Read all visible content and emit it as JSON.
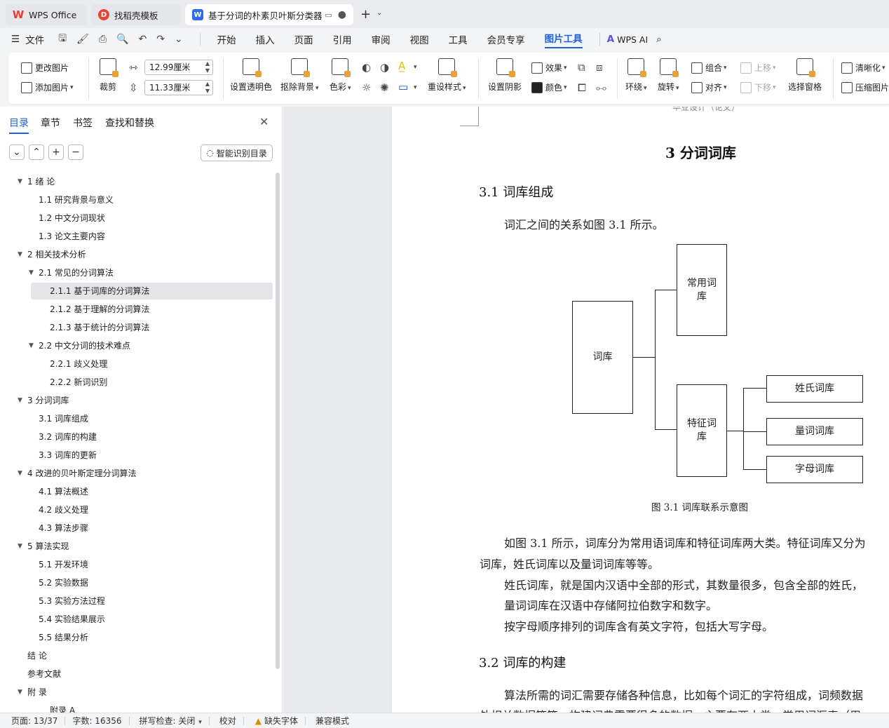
{
  "tabs": [
    {
      "label": "WPS Office",
      "icon": "wps-logo-icon"
    },
    {
      "label": "找稻壳模板",
      "icon": "docer-icon"
    },
    {
      "label": "基于分词的朴素贝叶斯分类器",
      "icon": "writer-doc-icon",
      "active": true
    }
  ],
  "menu": {
    "file": "文件",
    "tabs": [
      "开始",
      "插入",
      "页面",
      "引用",
      "审阅",
      "视图",
      "工具",
      "会员专享",
      "图片工具"
    ],
    "active_tab": "图片工具",
    "wps_ai": "WPS AI"
  },
  "ribbon": {
    "change_image": "更改图片",
    "add_image": "添加图片",
    "crop": "裁剪",
    "width_value": "12.99厘米",
    "height_value": "11.33厘米",
    "set_transparent": "设置透明色",
    "remove_bg": "抠除背景",
    "color": "色彩",
    "reset_style": "重设样式",
    "shadow": "设置阴影",
    "effect": "效果",
    "fill_color": "颜色",
    "wrap": "环绕",
    "rotate": "旋转",
    "group": "组合",
    "align": "对齐",
    "bring_forward": "上移",
    "send_backward": "下移",
    "selection_pane": "选择窗格",
    "sharpen": "清晰化",
    "compress": "压缩图片"
  },
  "nav": {
    "tabs": [
      "目录",
      "章节",
      "书签",
      "查找和替换"
    ],
    "active_tab": "目录",
    "smart_btn": "智能识别目录",
    "toc": [
      {
        "label": "1  绪  论",
        "level": 1,
        "expandable": true
      },
      {
        "label": "1.1 研究背景与意义",
        "level": 2
      },
      {
        "label": "1.2 中文分词现状",
        "level": 2
      },
      {
        "label": "1.3  论文主要内容",
        "level": 2
      },
      {
        "label": "2 相关技术分析",
        "level": 1,
        "expandable": true
      },
      {
        "label": "2.1 常见的分词算法",
        "level": 2,
        "expandable": true
      },
      {
        "label": "2.1.1 基于词库的分词算法",
        "level": 3,
        "selected": true
      },
      {
        "label": "2.1.2 基于理解的分词算法",
        "level": 3
      },
      {
        "label": "2.1.3 基于统计的分词算法",
        "level": 3
      },
      {
        "label": "2.2 中文分词的技术难点",
        "level": 2,
        "expandable": true
      },
      {
        "label": "2.2.1 歧义处理",
        "level": 3
      },
      {
        "label": "2.2.2 新词识别",
        "level": 3
      },
      {
        "label": "3 分词词库",
        "level": 1,
        "expandable": true
      },
      {
        "label": "3.1 词库组成",
        "level": 2
      },
      {
        "label": "3.2  词库的构建",
        "level": 2
      },
      {
        "label": "3.3  词库的更新",
        "level": 2
      },
      {
        "label": "4  改进的贝叶斯定理分词算法",
        "level": 1,
        "expandable": true
      },
      {
        "label": "4.1  算法概述",
        "level": 2
      },
      {
        "label": "4.2  歧义处理",
        "level": 2
      },
      {
        "label": "4.3  算法步骤",
        "level": 2
      },
      {
        "label": "5  算法实现",
        "level": 1,
        "expandable": true
      },
      {
        "label": "5.1  开发环境",
        "level": 2
      },
      {
        "label": "5.2  实验数据",
        "level": 2
      },
      {
        "label": "5.3  实验方法过程",
        "level": 2
      },
      {
        "label": "5.4  实验结果展示",
        "level": 2
      },
      {
        "label": "5.5 结果分析",
        "level": 2
      },
      {
        "label": "结  论",
        "level": 1
      },
      {
        "label": "参考文献",
        "level": 1
      },
      {
        "label": "附  录",
        "level": 1,
        "expandable": true
      },
      {
        "label": "附录 A",
        "level": 3
      }
    ]
  },
  "document": {
    "header_text": "毕业设计（论文）",
    "chapter_title": "3 分词词库",
    "section_1": "3.1 词库组成",
    "para_intro": "词汇之间的关系如图 3.1 所示。",
    "diagram": {
      "root": "词库",
      "common": "常用词库",
      "feature": "特征词库",
      "surname": "姓氏词库",
      "measure": "量词词库",
      "letter": "字母词库"
    },
    "caption": "图 3.1  词库联系示意图",
    "para_1a": "如图 3.1 所示，词库分为常用语词库和特征词库两大类。特征词库又分为",
    "para_1b": "词库，姓氏词库以及量词词库等等。",
    "para_2": "姓氏词库，就是国内汉语中全部的形式，其数量很多，包含全部的姓氏，",
    "para_3": "量词词库在汉语中存储阿拉伯数字和数字。",
    "para_4": "按字母顺序排列的词库含有英文字符，包括大写字母。",
    "section_2": "3.2  词库的构建",
    "para_5a": "算法所需的词汇需要存储各种信息，比如每个词汇的字符组成，词频数据",
    "para_5b": "外相关数据等等，构建词典需要很多的数据，主要有两大类，常用词汇表（用"
  },
  "status": {
    "page": "页面: 13/37",
    "words": "字数: 16356",
    "spell": "拼写检查: 关闭",
    "proofread": "校对",
    "missing_font": "缺失字体",
    "compat": "兼容模式"
  }
}
